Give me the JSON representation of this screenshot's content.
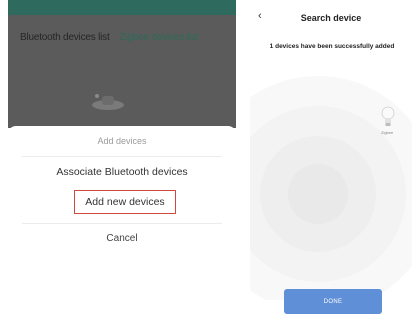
{
  "left": {
    "tabs": {
      "bluetooth": "Bluetooth devices list",
      "zigbee": "Zigbee devices list"
    },
    "sheet": {
      "title": "Add devices",
      "associate": "Associate Bluetooth devices",
      "add_new": "Add new devices",
      "cancel": "Cancel"
    }
  },
  "right": {
    "title": "Search device",
    "success_message": "1 devices have been successfully added",
    "device_label": "Zigbee",
    "done_label": "DONE"
  },
  "colors": {
    "zigbee_tab": "#2d6b58",
    "highlight_border": "#d04a3c",
    "done_button": "#5f8fd6"
  },
  "icons": {
    "back": "chevron-left-icon",
    "device": "light-bulb-icon"
  }
}
